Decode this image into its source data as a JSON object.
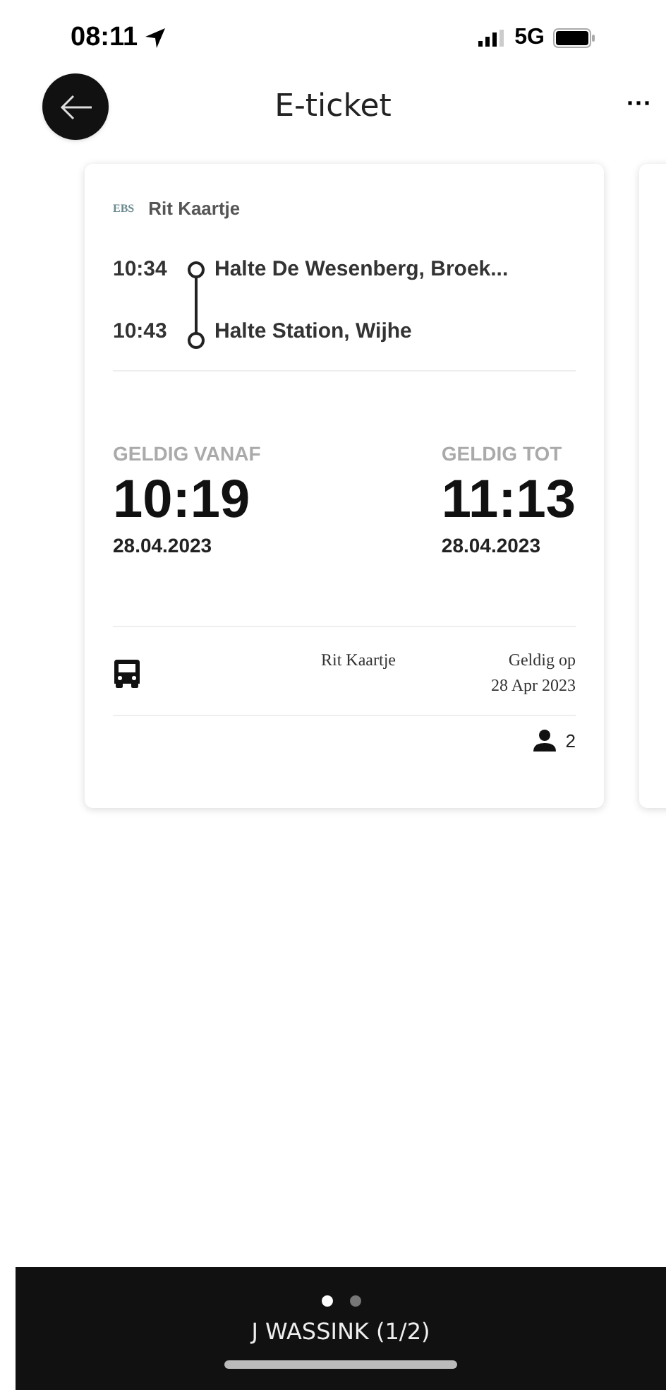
{
  "status_bar": {
    "time": "08:11",
    "network": "5G"
  },
  "header": {
    "title": "E-ticket",
    "menu": "···"
  },
  "ticket": {
    "logo": "EBS",
    "type": "Rit Kaartje",
    "stops": [
      {
        "time": "10:34",
        "name": "Halte De Wesenberg, Broek..."
      },
      {
        "time": "10:43",
        "name": "Halte Station, Wijhe"
      }
    ],
    "valid_from": {
      "label": "GELDIG VANAF",
      "time": "10:19",
      "date": "28.04.2023"
    },
    "valid_until": {
      "label": "GELDIG TOT",
      "time": "11:13",
      "date": "28.04.2023"
    },
    "product": "Rit Kaartje",
    "valid_on_label": "Geldig op",
    "valid_on_date": "28 Apr 2023",
    "passengers": "2"
  },
  "footer": {
    "pages": [
      {
        "selected": true
      },
      {
        "selected": false
      }
    ],
    "holder": "J WASSINK (1/2)"
  }
}
